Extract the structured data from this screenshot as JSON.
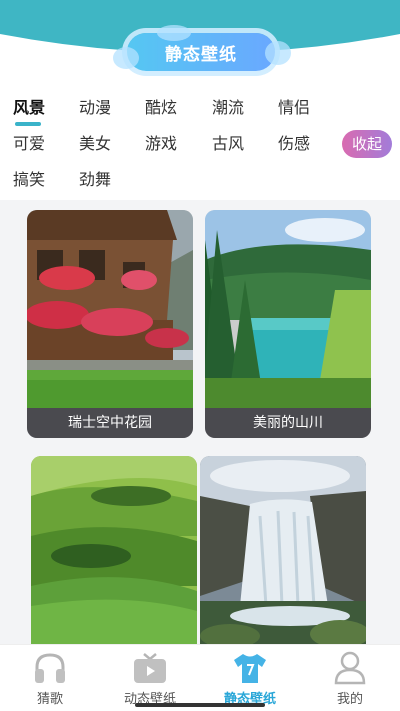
{
  "header": {
    "title": "静态壁纸"
  },
  "categories": {
    "row1": [
      "风景",
      "动漫",
      "酷炫",
      "潮流",
      "情侣"
    ],
    "row2": [
      "可爱",
      "美女",
      "游戏",
      "古风",
      "伤感"
    ],
    "row3": [
      "搞笑",
      "劲舞"
    ],
    "active": "风景",
    "collapse_label": "收起"
  },
  "wallpapers": [
    {
      "caption": "瑞士空中花园",
      "scene": "chalet-flowers"
    },
    {
      "caption": "美丽的山川",
      "scene": "alpine-lake"
    },
    {
      "caption": "",
      "scene": "green-hills"
    },
    {
      "caption": "",
      "scene": "waterfall"
    }
  ],
  "nav": {
    "items": [
      {
        "label": "猜歌",
        "icon": "headphones-icon"
      },
      {
        "label": "动态壁纸",
        "icon": "tv-icon"
      },
      {
        "label": "静态壁纸",
        "icon": "tshirt-icon"
      },
      {
        "label": "我的",
        "icon": "person-icon"
      }
    ],
    "active_index": 2
  },
  "colors": {
    "header_teal": "#3fb6c4",
    "accent": "#2aa7d8",
    "collapse_pink": "#d96bb0",
    "collapse_purple": "#a27cd9"
  }
}
